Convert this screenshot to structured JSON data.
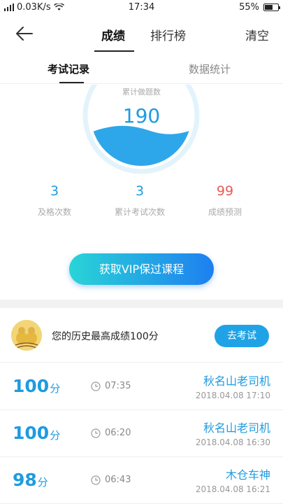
{
  "status_bar": {
    "network": "0.03K/s",
    "time": "17:34",
    "battery": "55%",
    "battery_level": 0.55
  },
  "header": {
    "tabs": [
      {
        "label": "成绩",
        "active": true
      },
      {
        "label": "排行榜",
        "active": false
      }
    ],
    "clear_label": "清空",
    "back_icon": "arrow-left-icon"
  },
  "sub_tabs": [
    {
      "label": "考试记录",
      "active": true
    },
    {
      "label": "数据统计",
      "active": false
    }
  ],
  "gauge": {
    "label": "累计做题数",
    "value": "190",
    "fill_fraction": 0.45,
    "color": "#2ea6ea"
  },
  "stats": [
    {
      "value": "3",
      "label": "及格次数",
      "color": "#1e9be0"
    },
    {
      "value": "3",
      "label": "累计考试次数",
      "color": "#1e9be0"
    },
    {
      "value": "99",
      "label": "成绩预测",
      "color": "#e85a5a"
    }
  ],
  "vip_button": "获取VIP保过课程",
  "best": {
    "text": "您的历史最高成绩100分",
    "button": "去考试"
  },
  "records": [
    {
      "score": "100",
      "unit": "分",
      "duration": "07:35",
      "name": "秋名山老司机",
      "date": "2018.04.08  17:10"
    },
    {
      "score": "100",
      "unit": "分",
      "duration": "06:20",
      "name": "秋名山老司机",
      "date": "2018.04.08  16:30"
    },
    {
      "score": "98",
      "unit": "分",
      "duration": "06:43",
      "name": "木仓车神",
      "date": "2018.04.08  16:21"
    }
  ],
  "colors": {
    "accent": "#1e9be0",
    "warning": "#e85a5a",
    "vip_gradient_start": "#29d4d7",
    "vip_gradient_end": "#1e7ff0"
  }
}
